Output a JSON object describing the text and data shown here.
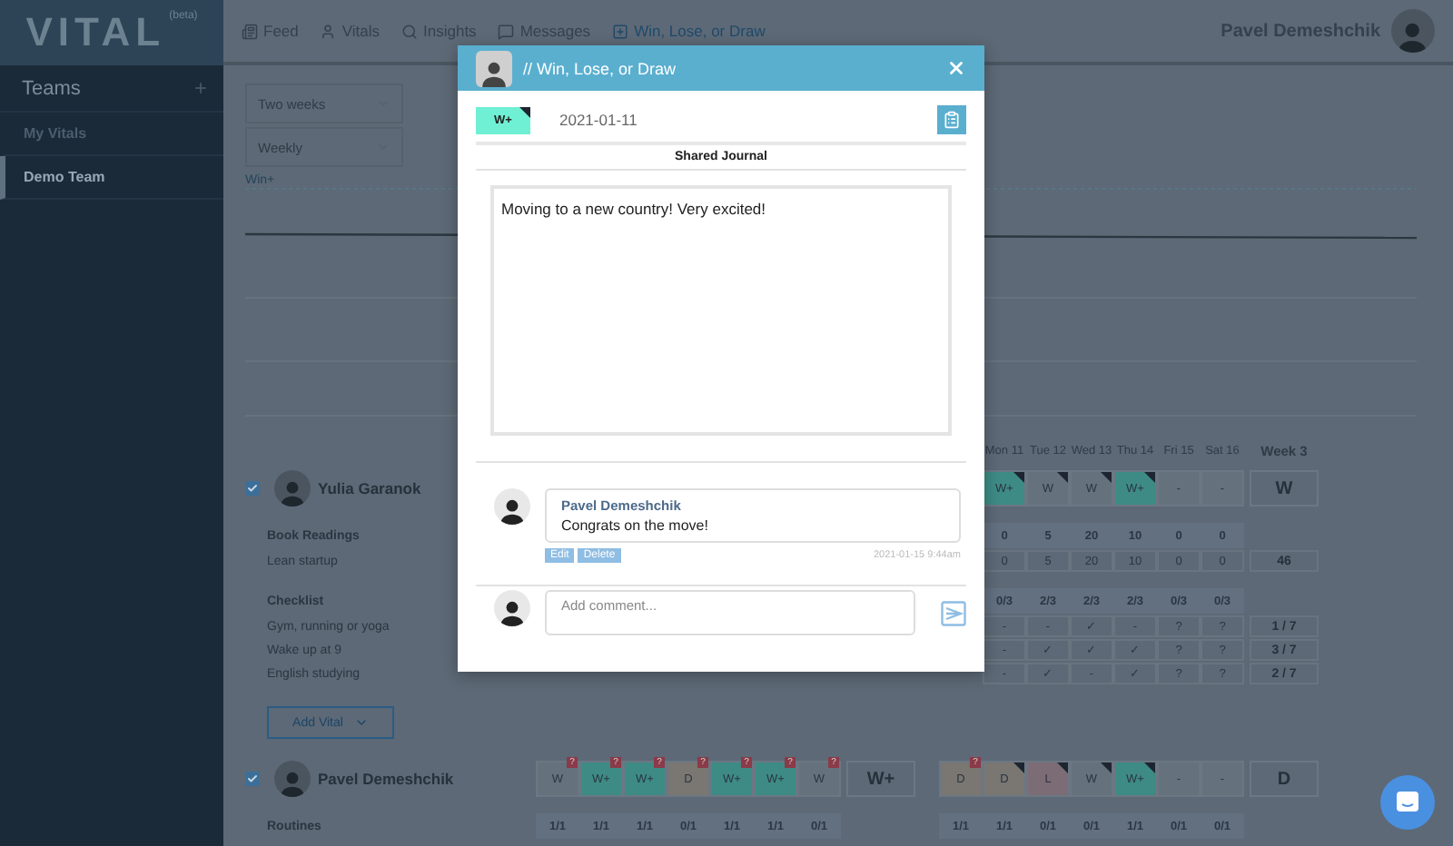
{
  "app": {
    "logo": "VITAL",
    "badge": "(beta)"
  },
  "nav": [
    {
      "label": "Feed",
      "kind": "feed",
      "selected": false
    },
    {
      "label": "Vitals",
      "kind": "vitals",
      "selected": false
    },
    {
      "label": "Insights",
      "kind": "insights",
      "selected": false
    },
    {
      "label": "Messages",
      "kind": "messages",
      "selected": false
    },
    {
      "label": "Win, Lose, or Draw",
      "kind": "add",
      "selected": true
    }
  ],
  "user": {
    "name": "Pavel Demeshchik"
  },
  "sidebar": {
    "title": "Teams",
    "items": [
      {
        "label": "My Vitals",
        "selected": false
      },
      {
        "label": "Demo Team",
        "selected": true
      }
    ]
  },
  "filters": [
    {
      "value": "Two weeks"
    },
    {
      "value": "Weekly"
    }
  ],
  "chart": {
    "legend": "Win+"
  },
  "week_header": {
    "days": [
      "Mon 11",
      "Tue 12",
      "Wed 13",
      "Thu 14",
      "Fri 15",
      "Sat 16"
    ],
    "total": "Week 3"
  },
  "members": [
    {
      "name": "Yulia Garanok",
      "checked": true,
      "results": {
        "week3": [
          {
            "label": "W+",
            "kind": "win_plus",
            "flagged": true
          },
          {
            "label": "W",
            "kind": "plain",
            "flagged": true
          },
          {
            "label": "W",
            "kind": "plain",
            "flagged": true
          },
          {
            "label": "W+",
            "kind": "win_plus",
            "flagged": true
          },
          {
            "label": "-",
            "kind": "plain",
            "flagged": false
          },
          {
            "label": "-",
            "kind": "plain",
            "flagged": false
          }
        ],
        "total3": "W"
      },
      "rows": [
        {
          "kind": "category",
          "label": "Book Readings",
          "week3": [
            "0",
            "5",
            "20",
            "10",
            "0",
            "0"
          ]
        },
        {
          "kind": "item",
          "label": "Lean startup",
          "week3": [
            "0",
            "5",
            "20",
            "10",
            "0",
            "0"
          ],
          "total3": "46"
        },
        {
          "kind": "category",
          "label": "Checklist",
          "week3": [
            "0/3",
            "2/3",
            "2/3",
            "2/3",
            "0/3",
            "0/3"
          ]
        },
        {
          "kind": "item",
          "label": "Gym, running or yoga",
          "week3": [
            "-",
            "-",
            "✓",
            "-",
            "?",
            "?"
          ],
          "total3": "1 / 7"
        },
        {
          "kind": "item",
          "label": "Wake up at 9",
          "week3": [
            "-",
            "✓",
            "✓",
            "✓",
            "?",
            "?"
          ],
          "total3": "3 / 7"
        },
        {
          "kind": "item",
          "label": "English studying",
          "week3": [
            "-",
            "✓",
            "-",
            "✓",
            "?",
            "?"
          ],
          "total3": "2 / 7"
        }
      ],
      "add_button": "Add Vital"
    },
    {
      "name": "Pavel Demeshchik",
      "checked": true,
      "results": {
        "week2": [
          {
            "label": "W",
            "kind": "plain",
            "flagged": false,
            "note": "?"
          },
          {
            "label": "W+",
            "kind": "win_plus",
            "flagged": false,
            "note": "?"
          },
          {
            "label": "W+",
            "kind": "win_plus",
            "flagged": false,
            "note": "?"
          },
          {
            "label": "D",
            "kind": "draw",
            "flagged": false,
            "note": "?"
          },
          {
            "label": "W+",
            "kind": "win_plus",
            "flagged": false,
            "note": "?"
          },
          {
            "label": "W+",
            "kind": "win_plus",
            "flagged": false,
            "note": "?"
          },
          {
            "label": "W",
            "kind": "plain",
            "flagged": false,
            "note": "?"
          }
        ],
        "total2": "W+",
        "week3": [
          {
            "label": "D",
            "kind": "draw",
            "flagged": false,
            "note": "?"
          },
          {
            "label": "D",
            "kind": "draw",
            "flagged": true
          },
          {
            "label": "L",
            "kind": "loss",
            "flagged": true
          },
          {
            "label": "W",
            "kind": "plain",
            "flagged": true
          },
          {
            "label": "W+",
            "kind": "win_plus",
            "flagged": true
          },
          {
            "label": "-",
            "kind": "plain",
            "flagged": false
          },
          {
            "label": "-",
            "kind": "plain",
            "flagged": false
          }
        ],
        "total3": "D"
      },
      "rows": [
        {
          "kind": "category",
          "label": "Routines",
          "week2": [
            "1/1",
            "1/1",
            "1/1",
            "0/1",
            "1/1",
            "1/1",
            "0/1"
          ],
          "week3": [
            "1/1",
            "1/1",
            "0/1",
            "0/1",
            "1/1",
            "0/1",
            "0/1"
          ]
        }
      ]
    }
  ],
  "dialog": {
    "title": "// Win, Lose, or Draw",
    "result": {
      "label": "W+",
      "kind": "win_plus",
      "flagged": true
    },
    "date": "2021-01-11",
    "section_title": "Shared Journal",
    "journal": "Moving to a new country! Very excited!",
    "comments": [
      {
        "author": "Pavel Demeshchik",
        "text": "Congrats on the move!",
        "actions": [
          "Edit",
          "Delete"
        ],
        "time": "2021-01-15 9:44am"
      }
    ],
    "comment_input": {
      "placeholder": "Add comment..."
    }
  }
}
